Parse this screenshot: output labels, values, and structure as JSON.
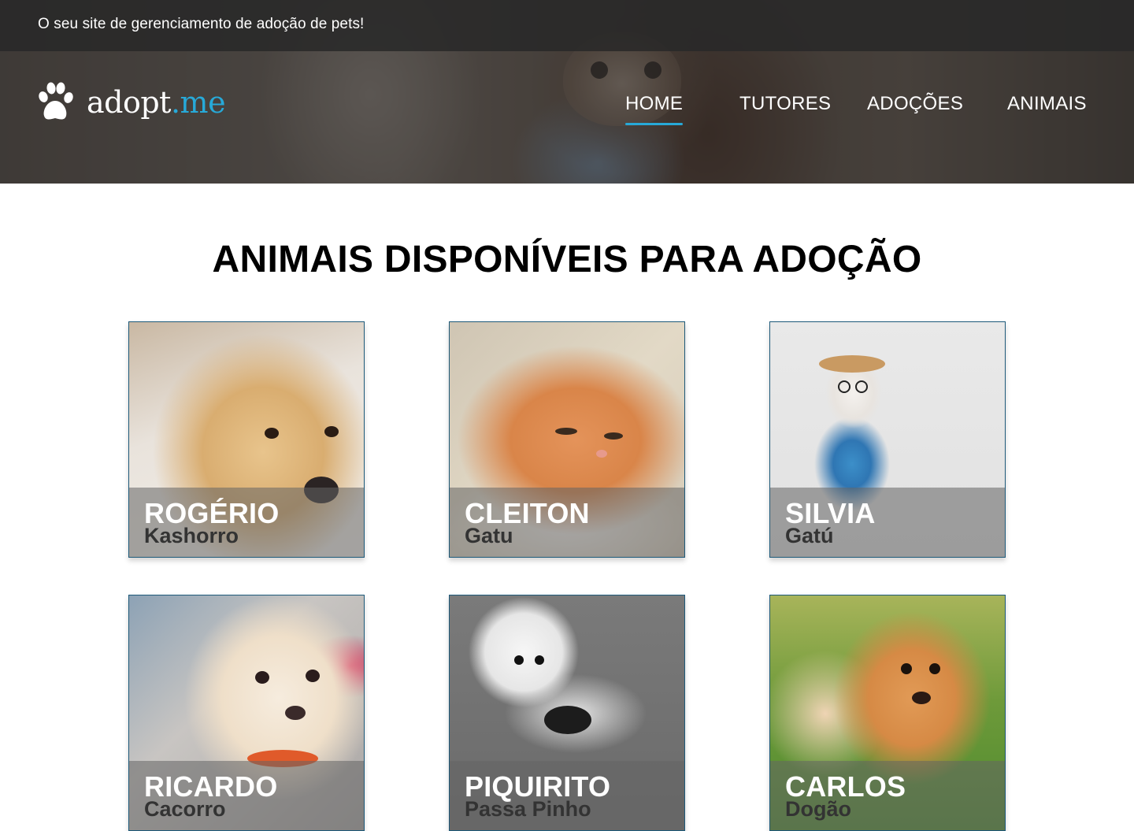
{
  "topbar": {
    "tagline": "O seu site de gerenciamento de adoção de pets!"
  },
  "logo": {
    "text_main": "adopt",
    "text_accent": ".me",
    "icon": "paw-icon"
  },
  "nav": {
    "items": [
      {
        "label": "HOME",
        "active": true
      },
      {
        "label": "TUTORES",
        "active": false
      },
      {
        "label": "ADOÇÕES",
        "active": false
      },
      {
        "label": "ANIMAIS",
        "active": false
      }
    ]
  },
  "main": {
    "title": "ANIMAIS DISPONÍVEIS PARA ADOÇÃO"
  },
  "animals": [
    {
      "name": "ROGÉRIO",
      "species": "Kashorro"
    },
    {
      "name": "CLEITON",
      "species": "Gatu"
    },
    {
      "name": "SILVIA",
      "species": "Gatú"
    },
    {
      "name": "RICARDO",
      "species": "Cacorro"
    },
    {
      "name": "PIQUIRITO",
      "species": "Passa Pinho"
    },
    {
      "name": "CARLOS",
      "species": "Dogão"
    }
  ],
  "colors": {
    "accent": "#27a9d8",
    "topbar": "#282828",
    "card_border": "#1e5a7a"
  }
}
